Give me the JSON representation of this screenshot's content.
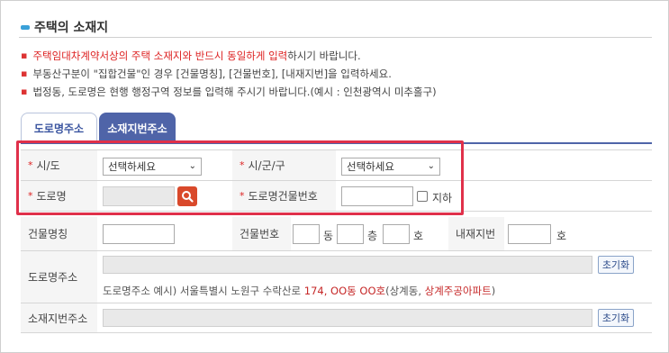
{
  "section": {
    "title": "주택의 소재지"
  },
  "notes": {
    "n1_red": "주택임대차계약서상의 주택 소재지와 반드시 동일하게 입력",
    "n1_rest": "하시기 바랍니다.",
    "n2": "부동산구분이 \"집합건물\"인 경우 [건물명칭], [건물번호], [내재지번]을 입력하세요.",
    "n3": "법정동, 도로명은 현행 행정구역 정보를 입력해 주시기 바랍니다.(예시 : 인천광역시 미추홀구)"
  },
  "tabs": {
    "road": "도로명주소",
    "lot": "소재지번주소"
  },
  "form": {
    "sido_label": "시/도",
    "sido_value": "선택하세요",
    "sigungu_label": "시/군/구",
    "sigungu_value": "선택하세요",
    "road_label": "도로명",
    "bldgno_label": "도로명건물번호",
    "basement_label": "지하",
    "bldgname_label": "건물명칭",
    "bldgnum_label": "건물번호",
    "dong_unit": "동",
    "floor_unit": "층",
    "ho_unit": "호",
    "inner_label": "내재지번",
    "inner_unit": "호",
    "roadaddr_label": "도로명주소",
    "lotaddr_label": "소재지번주소",
    "reset": "초기화",
    "example_prefix": "도로명주소 예시) 서울특별시 노원구 수락산로 ",
    "example_red1": "174, OO동 OO호",
    "example_mid": "(상계동, ",
    "example_red2": "상계주공아파트",
    "example_suffix": ")"
  },
  "colors": {
    "accent": "#4f64a8",
    "required": "#d22",
    "search": "#d9492b",
    "highlight": "#e0304a"
  }
}
